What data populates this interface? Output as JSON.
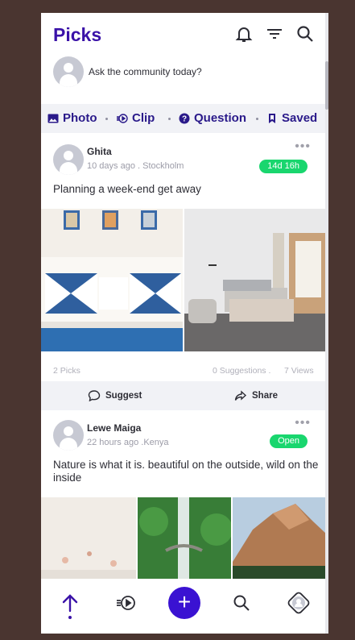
{
  "app": {
    "title": "Picks"
  },
  "ask": {
    "prompt": "Ask the community today?"
  },
  "tabs": [
    {
      "label": "Photo",
      "icon": "image-icon"
    },
    {
      "label": "Clip",
      "icon": "video-clip-icon"
    },
    {
      "label": "Question",
      "icon": "question-icon"
    },
    {
      "label": "Saved",
      "icon": "bookmark-icon"
    }
  ],
  "posts": [
    {
      "author": "Ghita",
      "meta": "10 days ago . Stockholm",
      "badge": "14d 16h",
      "content": "Planning a week-end get away",
      "stats": {
        "picks": "2 Picks",
        "suggestions": "0 Suggestions .",
        "views": "7 Views"
      },
      "actions": {
        "suggest": "Suggest",
        "share": "Share"
      }
    },
    {
      "author": "Lewe Maiga",
      "meta": "22 hours ago .Kenya",
      "badge": "Open",
      "content": "Nature is what it is. beautiful on the outside, wild on the inside"
    }
  ],
  "colors": {
    "accent": "#3a12a8",
    "badge": "#19d66e",
    "fab": "#3a12d2"
  },
  "bottom_nav": [
    "picks-arrow-icon",
    "clip-icon",
    "add-icon",
    "search-icon",
    "profile-icon"
  ],
  "fab_label": "+"
}
